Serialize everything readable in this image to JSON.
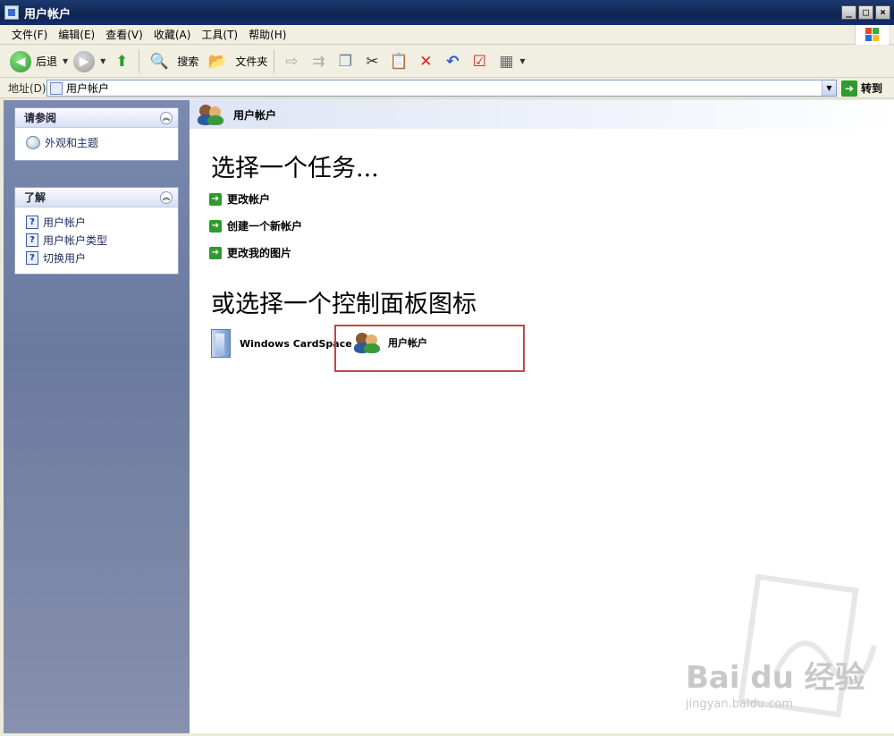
{
  "window": {
    "title": "用户帐户",
    "minimize": "_",
    "maximize": "□",
    "close": "×"
  },
  "menu": [
    "文件(F)",
    "编辑(E)",
    "查看(V)",
    "收藏(A)",
    "工具(T)",
    "帮助(H)"
  ],
  "toolbar": {
    "back_label": "后退",
    "search_label": "搜索",
    "folders_label": "文件夹"
  },
  "address": {
    "label": "地址(D)",
    "value": "用户帐户",
    "go_label": "转到"
  },
  "sidebar": {
    "see_also": {
      "title": "请参阅",
      "items": [
        "外观和主题"
      ]
    },
    "learn": {
      "title": "了解",
      "items": [
        "用户帐户",
        "用户帐户类型",
        "切换用户"
      ]
    }
  },
  "main": {
    "header": "用户帐户",
    "task_heading": "选择一个任务...",
    "tasks": [
      "更改帐户",
      "创建一个新帐户",
      "更改我的图片"
    ],
    "icon_heading": "或选择一个控制面板图标",
    "icons": [
      {
        "label": "Windows CardSpace",
        "icon": "cardspace-icon"
      },
      {
        "label": "用户帐户",
        "icon": "user-accounts-icon"
      }
    ]
  },
  "watermark": {
    "brand": "Bai du 经验",
    "url": "jingyan.baidu.com"
  },
  "colors": {
    "title_bar": "#0e2450",
    "left_pane": "#7a8aae",
    "highlight": "#c0464a",
    "go_green": "#2d9b2d"
  }
}
